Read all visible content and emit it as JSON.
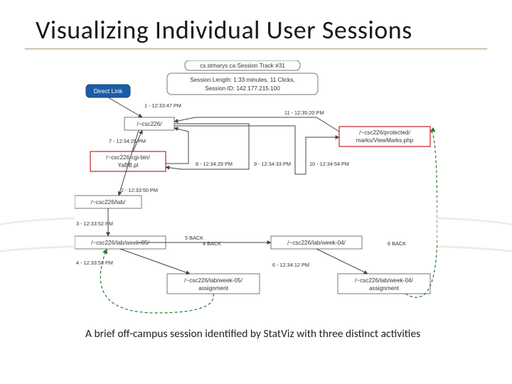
{
  "slide": {
    "title": "Visualizing Individual User Sessions",
    "caption": "A brief off-campus session identified by StatViz with three distinct activities"
  },
  "diagram": {
    "header_strip": "cs.stmarys.ca Session Track #31",
    "info_box_line1": "Session Length: 1:33 minutes, 11 Clicks,",
    "info_box_line2": "Session ID: 142.177.215.100",
    "start_label": "Direct Link",
    "nodes": {
      "root": "/~csc226/",
      "cgi": "/~csc226/cgi-bin/\nYaBB.pl",
      "lab": "/~csc226/lab/",
      "wk05": "/~csc226/lab/week-05/",
      "wk05a": "/~csc226/lab/week-05/\nassignment",
      "wk04": "/~csc226/lab/week-04/",
      "wk04a": "/~csc226/lab/week-04/\nassignment",
      "prot": "/~csc226/protected/\nmarks/ViewMarks.php"
    },
    "edge_labels": {
      "e1": "1 - 12:33:47 PM",
      "e2": "2 - 12:33:50 PM",
      "e3": "3 - 12:33:52 PM",
      "e4": "4 - 12:33:53 PM",
      "e5": "5 BACK",
      "e6": "6 - 12:34:12 PM",
      "e7": "7 - 12:34:25 PM",
      "e8": "8 - 12:34:29 PM",
      "e9": "9 - 12:34:33 PM",
      "e10": "10 - 12:34:54 PM",
      "e11": "11 - 12:35:20 PM",
      "b4": "4 BACK",
      "b6": "6 BACK"
    }
  }
}
